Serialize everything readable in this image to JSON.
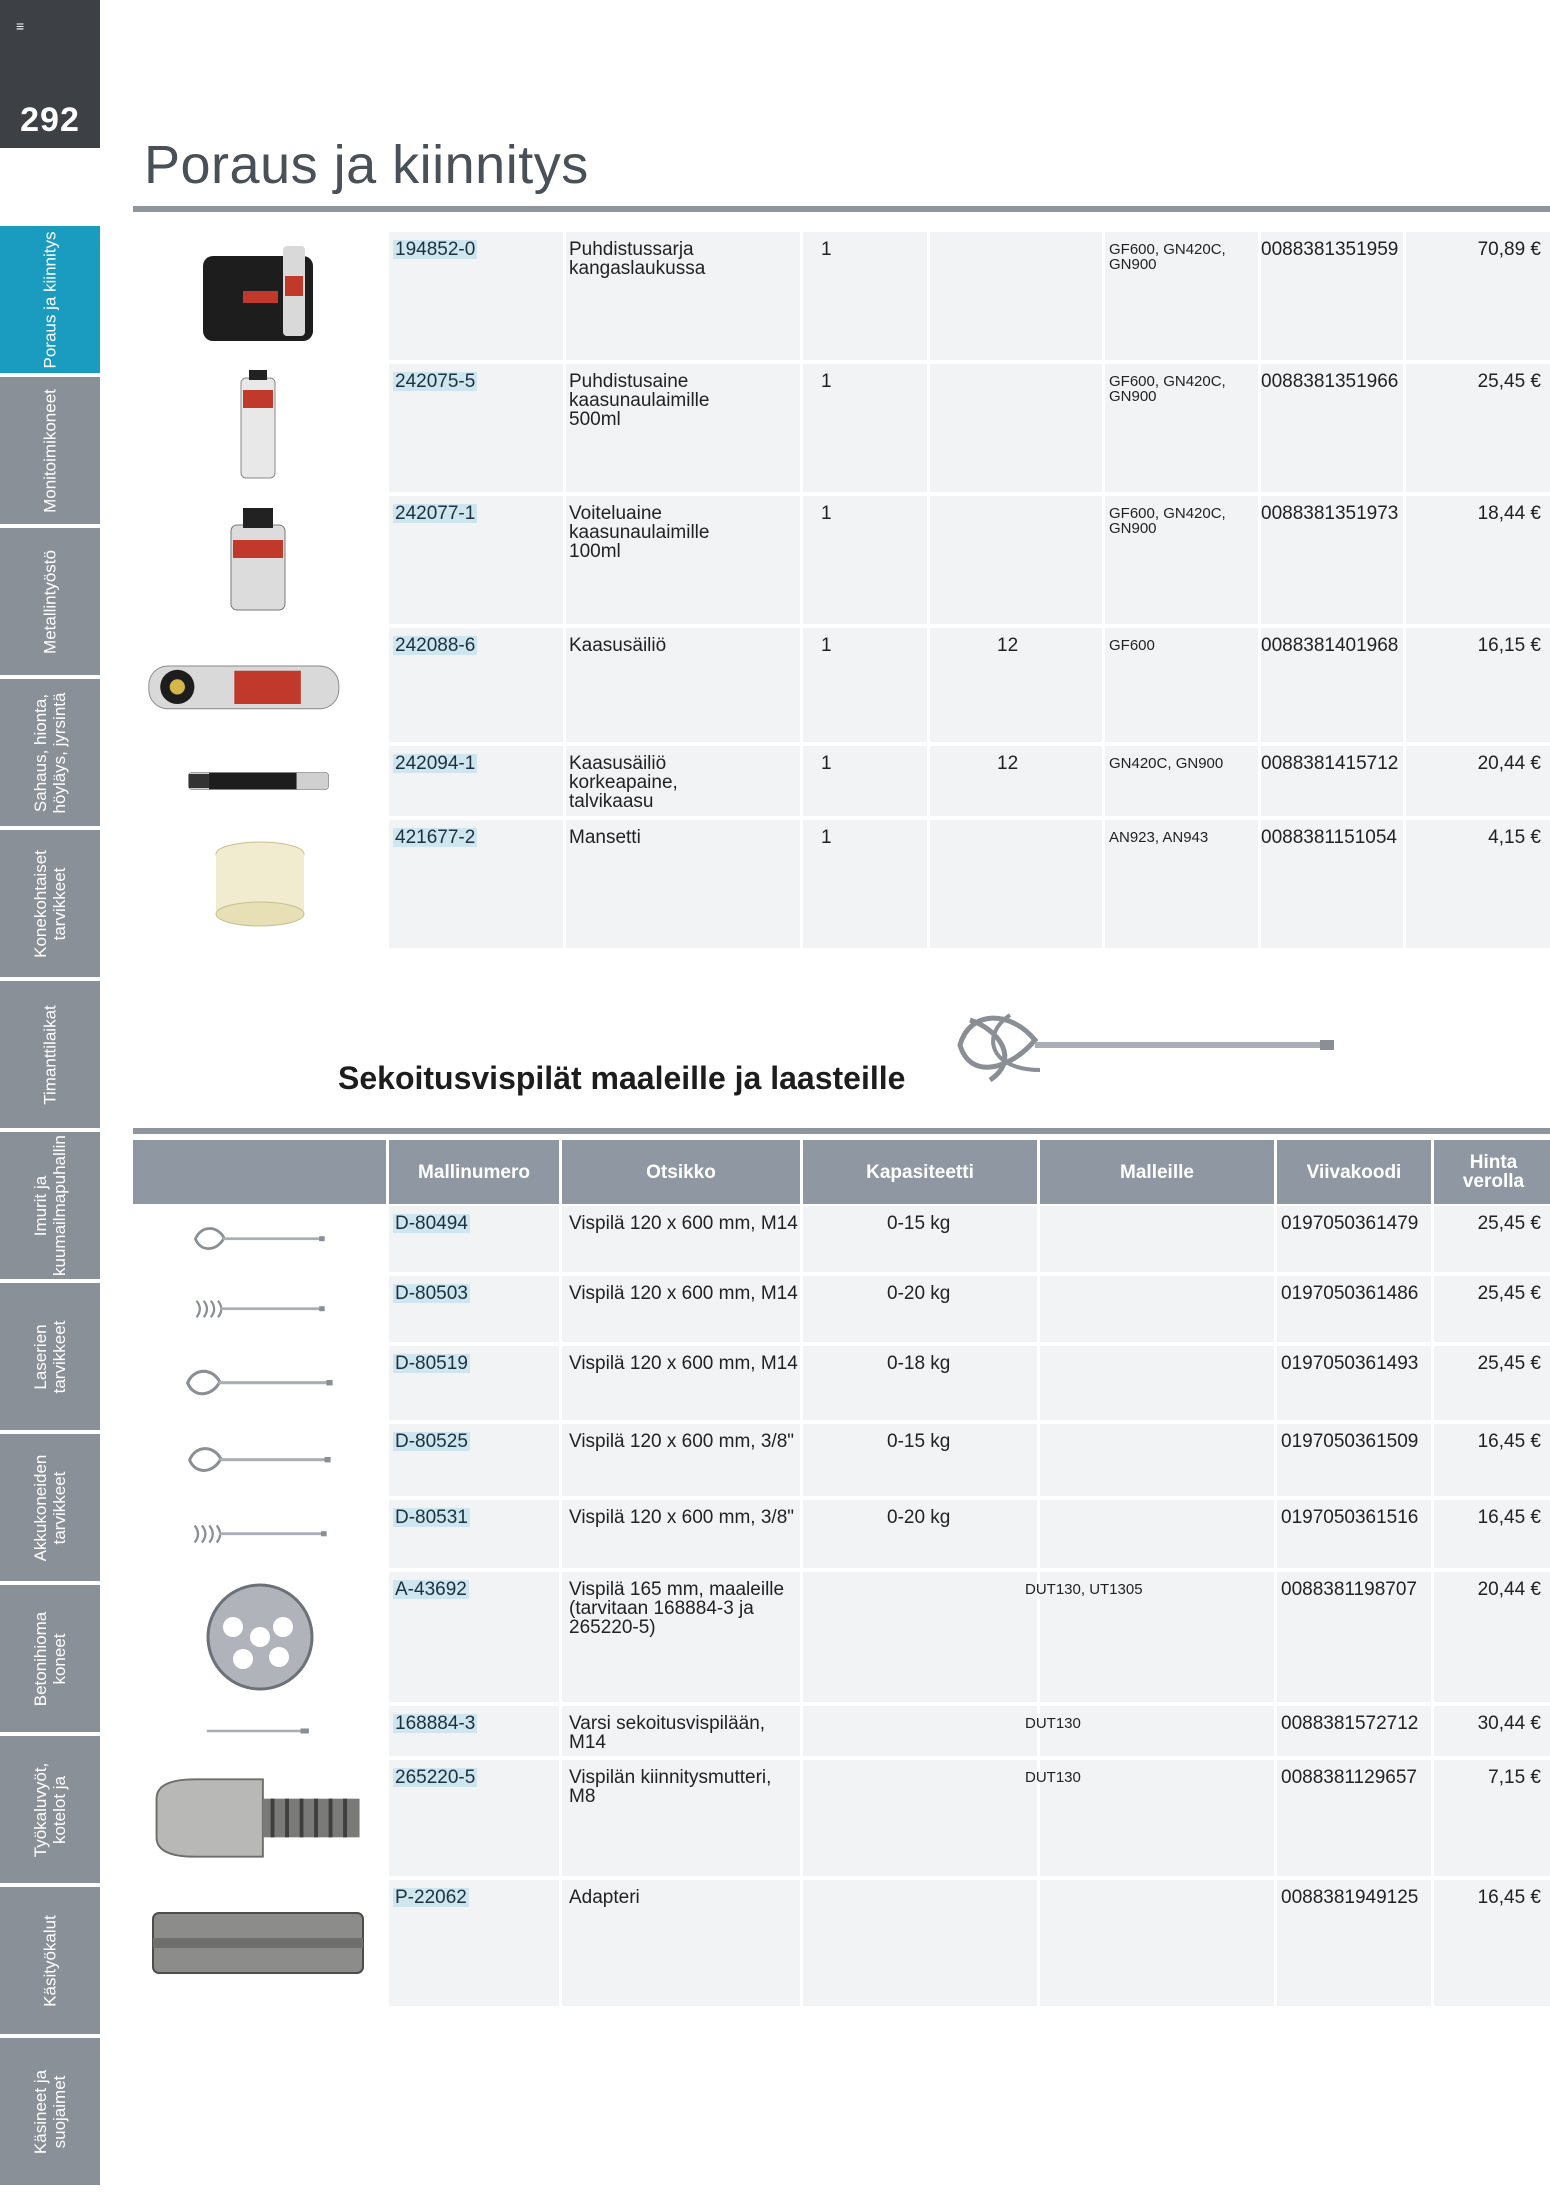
{
  "page": {
    "number": "292",
    "title": "Poraus ja kiinnitys",
    "menu_glyph": "≡"
  },
  "side_tabs": [
    {
      "label": "Poraus ja kiinnitys",
      "active": true
    },
    {
      "label": "Monitoimikoneet",
      "active": false
    },
    {
      "label": "Metallintyöstö",
      "active": false
    },
    {
      "label": "Sahaus, hionta, höyläys, jyrsintä",
      "active": false
    },
    {
      "label": "Konekohtaiset tarvikkeet",
      "active": false
    },
    {
      "label": "Timanttilaikat",
      "active": false
    },
    {
      "label": "Imurit ja kuumailmapuhallin",
      "active": false
    },
    {
      "label": "Laserien tarvikkeet",
      "active": false
    },
    {
      "label": "Akkukoneiden tarvikkeet",
      "active": false
    },
    {
      "label": "Betonihioma koneet",
      "active": false
    },
    {
      "label": "Työkaluvyöt, kotelot ja",
      "active": false
    },
    {
      "label": "Käsityökalut",
      "active": false
    },
    {
      "label": "Käsineet ja suojaimet",
      "active": false
    }
  ],
  "table1": {
    "rows": [
      {
        "num": "194852-0",
        "title": "Puhdistussarja kangaslaukussa",
        "cap1": "1",
        "cap2": "",
        "models": "GF600, GN420C, GN900",
        "barcode": "0088381351959",
        "price": "70,89 €",
        "image": "cleaning-kit"
      },
      {
        "num": "242075-5",
        "title": "Puhdistusaine kaasunaulaimille 500ml",
        "cap1": "1",
        "cap2": "",
        "models": "GF600, GN420C, GN900",
        "barcode": "0088381351966",
        "price": "25,45 €",
        "image": "spray-can"
      },
      {
        "num": "242077-1",
        "title": "Voiteluaine kaasunaulaimille 100ml",
        "cap1": "1",
        "cap2": "",
        "models": "GF600, GN420C, GN900",
        "barcode": "0088381351973",
        "price": "18,44 €",
        "image": "oil-bottle"
      },
      {
        "num": "242088-6",
        "title": "Kaasusäiliö",
        "cap1": "1",
        "cap2": "12",
        "models": "GF600",
        "barcode": "0088381401968",
        "price": "16,15 €",
        "image": "gas-cell"
      },
      {
        "num": "242094-1",
        "title": "Kaasusäiliö korkeapaine, talvikaasu",
        "cap1": "1",
        "cap2": "12",
        "models": "GN420C, GN900",
        "barcode": "0088381415712",
        "price": "20,44 €",
        "image": "fuel-cell"
      },
      {
        "num": "421677-2",
        "title": "Mansetti",
        "cap1": "1",
        "cap2": "",
        "models": "AN923, AN943",
        "barcode": "0088381151054",
        "price": "4,15 €",
        "image": "sleeve"
      }
    ]
  },
  "section2": {
    "title": "Sekoitusvispilät maaleille ja laasteille",
    "headers": {
      "num": "Mallinumero",
      "title": "Otsikko",
      "cap": "Kapasiteetti",
      "models": "Malleille",
      "barcode": "Viivakoodi",
      "price": "Hinta verolla"
    },
    "rows": [
      {
        "num": "D-80494",
        "title": "Vispilä 120 x 600 mm, M14",
        "cap": "0-15 kg",
        "models": "",
        "barcode": "0197050361479",
        "price": "25,45 €",
        "image": "whisk"
      },
      {
        "num": "D-80503",
        "title": "Vispilä 120 x 600 mm, M14",
        "cap": "0-20 kg",
        "models": "",
        "barcode": "0197050361486",
        "price": "25,45 €",
        "image": "whisk-spiral"
      },
      {
        "num": "D-80519",
        "title": "Vispilä 120 x 600 mm, M14",
        "cap": "0-18 kg",
        "models": "",
        "barcode": "0197050361493",
        "price": "25,45 €",
        "image": "whisk"
      },
      {
        "num": "D-80525",
        "title": "Vispilä 120 x 600 mm, 3/8\"",
        "cap": "0-15 kg",
        "models": "",
        "barcode": "0197050361509",
        "price": "16,45 €",
        "image": "whisk"
      },
      {
        "num": "D-80531",
        "title": "Vispilä 120 x 600 mm, 3/8\"",
        "cap": "0-20 kg",
        "models": "",
        "barcode": "0197050361516",
        "price": "16,45 €",
        "image": "whisk-spiral"
      },
      {
        "num": "A-43692",
        "title": "Vispilä 165 mm, maaleille (tarvitaan 168884-3 ja 265220-5)",
        "cap": "",
        "models": "DUT130, UT1305",
        "barcode": "0088381198707",
        "price": "20,44 €",
        "image": "disc"
      },
      {
        "num": "168884-3",
        "title": "Varsi sekoitusvispilään, M14",
        "cap": "",
        "models": "DUT130",
        "barcode": "0088381572712",
        "price": "30,44 €",
        "image": "shaft"
      },
      {
        "num": "265220-5",
        "title": "Vispilän kiinnitysmutteri, M8",
        "cap": "",
        "models": "DUT130",
        "barcode": "0088381129657",
        "price": "7,15 €",
        "image": "nut"
      },
      {
        "num": "P-22062",
        "title": "Adapteri",
        "cap": "",
        "models": "",
        "barcode": "0088381949125",
        "price": "16,45 €",
        "image": "adapter"
      }
    ]
  },
  "colors": {
    "accent": "#1a9cc0",
    "tab_grey": "#8a9097",
    "header_grey": "#8f98a2",
    "row_bg": "#f2f3f5"
  }
}
